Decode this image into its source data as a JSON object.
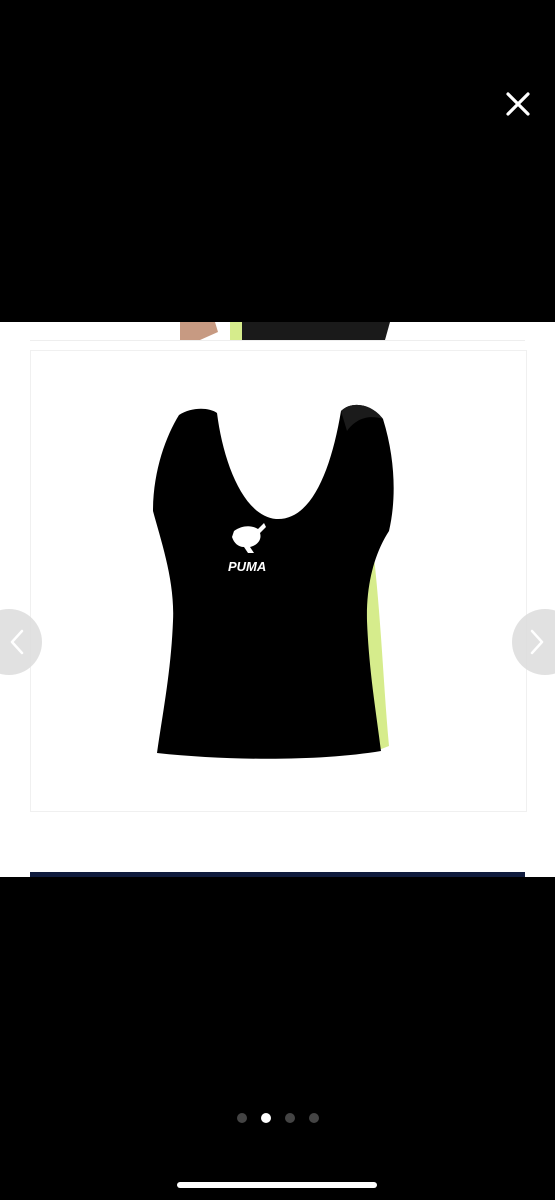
{
  "viewer": {
    "close_icon": "close-icon",
    "prev_icon": "chevron-left-icon",
    "next_icon": "chevron-right-icon",
    "page_indicator": {
      "total": 4,
      "current": 2
    }
  },
  "product": {
    "logo_text": "PUMA",
    "garment_color": "#000000",
    "accent_color": "#d6ec8c"
  },
  "colors": {
    "background": "#000000",
    "frame": "#ffffff",
    "nav_button": "#dcdcdc",
    "dot_active": "#ffffff",
    "dot_inactive": "#444444",
    "blue_line": "#0f1b3d"
  }
}
